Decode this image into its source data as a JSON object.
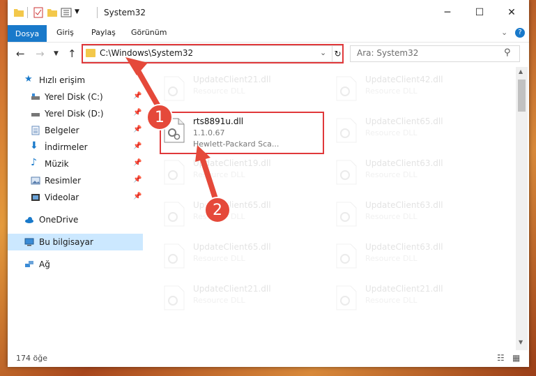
{
  "window": {
    "title": "System32"
  },
  "ribbon": {
    "tabs": [
      "Dosya",
      "Giriş",
      "Paylaş",
      "Görünüm"
    ]
  },
  "address": {
    "path": "C:\\Windows\\System32"
  },
  "search": {
    "placeholder": "Ara: System32"
  },
  "sidebar": {
    "items": [
      {
        "label": "Hızlı erişim",
        "icon": "star-icon"
      },
      {
        "label": "Yerel Disk (C:)",
        "icon": "drive-icon",
        "pinned": true
      },
      {
        "label": "Yerel Disk (D:)",
        "icon": "drive-icon",
        "pinned": true
      },
      {
        "label": "Belgeler",
        "icon": "document-icon",
        "pinned": true
      },
      {
        "label": "İndirmeler",
        "icon": "download-icon",
        "pinned": true
      },
      {
        "label": "Müzik",
        "icon": "music-icon",
        "pinned": true
      },
      {
        "label": "Resimler",
        "icon": "picture-icon",
        "pinned": true
      },
      {
        "label": "Videolar",
        "icon": "video-icon",
        "pinned": true
      },
      {
        "label": "OneDrive",
        "icon": "cloud-icon"
      },
      {
        "label": "Bu bilgisayar",
        "icon": "computer-icon",
        "selected": true
      },
      {
        "label": "Ağ",
        "icon": "network-icon"
      }
    ]
  },
  "files": {
    "left": [
      {
        "name": "UpdateClient21.dll",
        "type": "Resource DLL"
      },
      {
        "name": "rts8891u.dll",
        "version": "1.1.0.67",
        "company": "Hewlett-Packard Sca..."
      },
      {
        "name": "UpdateClient19.dll",
        "type": "Resource DLL"
      },
      {
        "name": "UpdateClient65.dll",
        "type": "Resource DLL"
      },
      {
        "name": "UpdateClient65.dll",
        "type": "Resource DLL"
      },
      {
        "name": "UpdateClient21.dll",
        "type": "Resource DLL"
      }
    ],
    "right": [
      {
        "name": "UpdateClient42.dll",
        "type": "Resource DLL"
      },
      {
        "name": "UpdateClient65.dll",
        "type": "Resource DLL"
      },
      {
        "name": "UpdateClient63.dll",
        "type": "Resource DLL"
      },
      {
        "name": "UpdateClient63.dll",
        "type": "Resource DLL"
      },
      {
        "name": "UpdateClient63.dll",
        "type": "Resource DLL"
      },
      {
        "name": "UpdateClient21.dll",
        "type": "Resource DLL"
      }
    ]
  },
  "status": {
    "count": "174 öğe"
  },
  "annotations": {
    "badge1": "1",
    "badge2": "2"
  },
  "colors": {
    "accent": "#1979ca",
    "highlight": "#e0383a",
    "badge": "#e5493a"
  }
}
